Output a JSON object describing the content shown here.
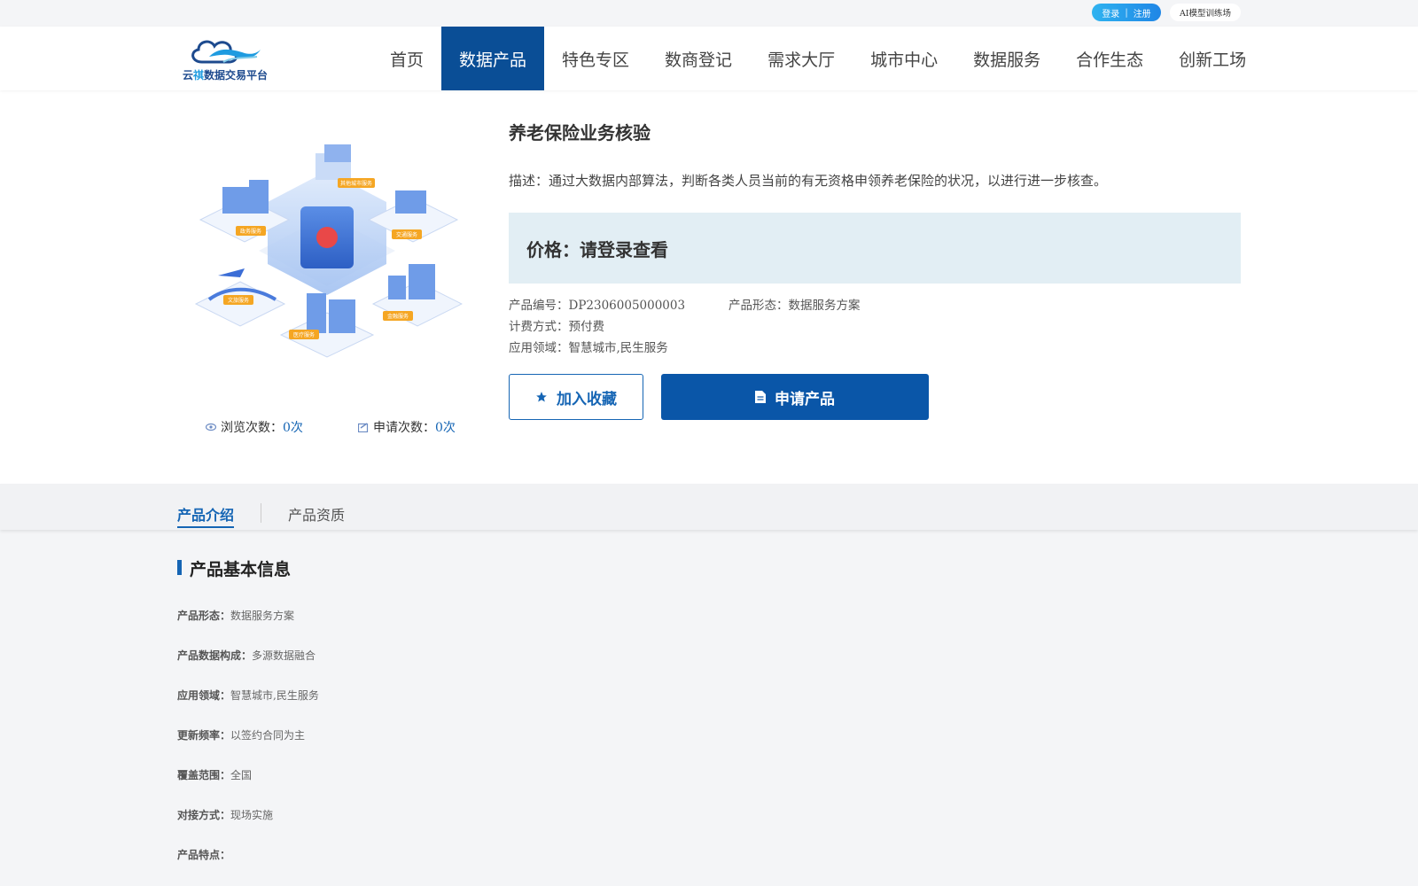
{
  "topbar": {
    "login": "登录",
    "separator": "|",
    "register": "注册",
    "ai_link": "AI模型训练场"
  },
  "logo": {
    "text_prefix": "云",
    "text_highlight": "祺",
    "text_suffix": "数据交易平台"
  },
  "nav": {
    "items": [
      {
        "label": "首页"
      },
      {
        "label": "数据产品"
      },
      {
        "label": "特色专区"
      },
      {
        "label": "数商登记"
      },
      {
        "label": "需求大厅"
      },
      {
        "label": "城市中心"
      },
      {
        "label": "数据服务"
      },
      {
        "label": "合作生态"
      },
      {
        "label": "创新工场"
      }
    ],
    "active_index": 1
  },
  "illustration": {
    "labels": [
      "其他城市服务",
      "政务服务",
      "交通服务",
      "文旅服务",
      "医疗服务",
      "金融服务"
    ]
  },
  "product": {
    "title": "养老保险业务核验",
    "description": "描述：通过大数据内部算法，判断各类人员当前的有无资格申领养老保险的状况，以进行进一步核查。",
    "price": "价格：请登录查看",
    "code": "产品编号：DP2306005000003",
    "form": "产品形态：数据服务方案",
    "billing": "计费方式：预付费",
    "domain": "应用领域：智慧城市,民生服务",
    "fav_button": "加入收藏",
    "apply_button": "申请产品"
  },
  "stats": {
    "views_label": "浏览次数：",
    "views_value": "0次",
    "applies_label": "申请次数：",
    "applies_value": "0次"
  },
  "tabs": [
    {
      "label": "产品介绍"
    },
    {
      "label": "产品资质"
    }
  ],
  "info": {
    "section_title": "产品基本信息",
    "rows": [
      {
        "key": "产品形态：",
        "value": "数据服务方案"
      },
      {
        "key": "产品数据构成：",
        "value": "多源数据融合"
      },
      {
        "key": "应用领域：",
        "value": "智慧城市,民生服务"
      },
      {
        "key": "更新频率：",
        "value": "以签约合同为主"
      },
      {
        "key": "覆盖范围：",
        "value": "全国"
      },
      {
        "key": "对接方式：",
        "value": "现场实施"
      },
      {
        "key": "产品特点：",
        "value": ""
      }
    ]
  },
  "colors": {
    "primary": "#0a56a8",
    "nav_active": "#0a4e96",
    "price_bg": "#e2eef4",
    "link_blue": "#1565b4"
  }
}
